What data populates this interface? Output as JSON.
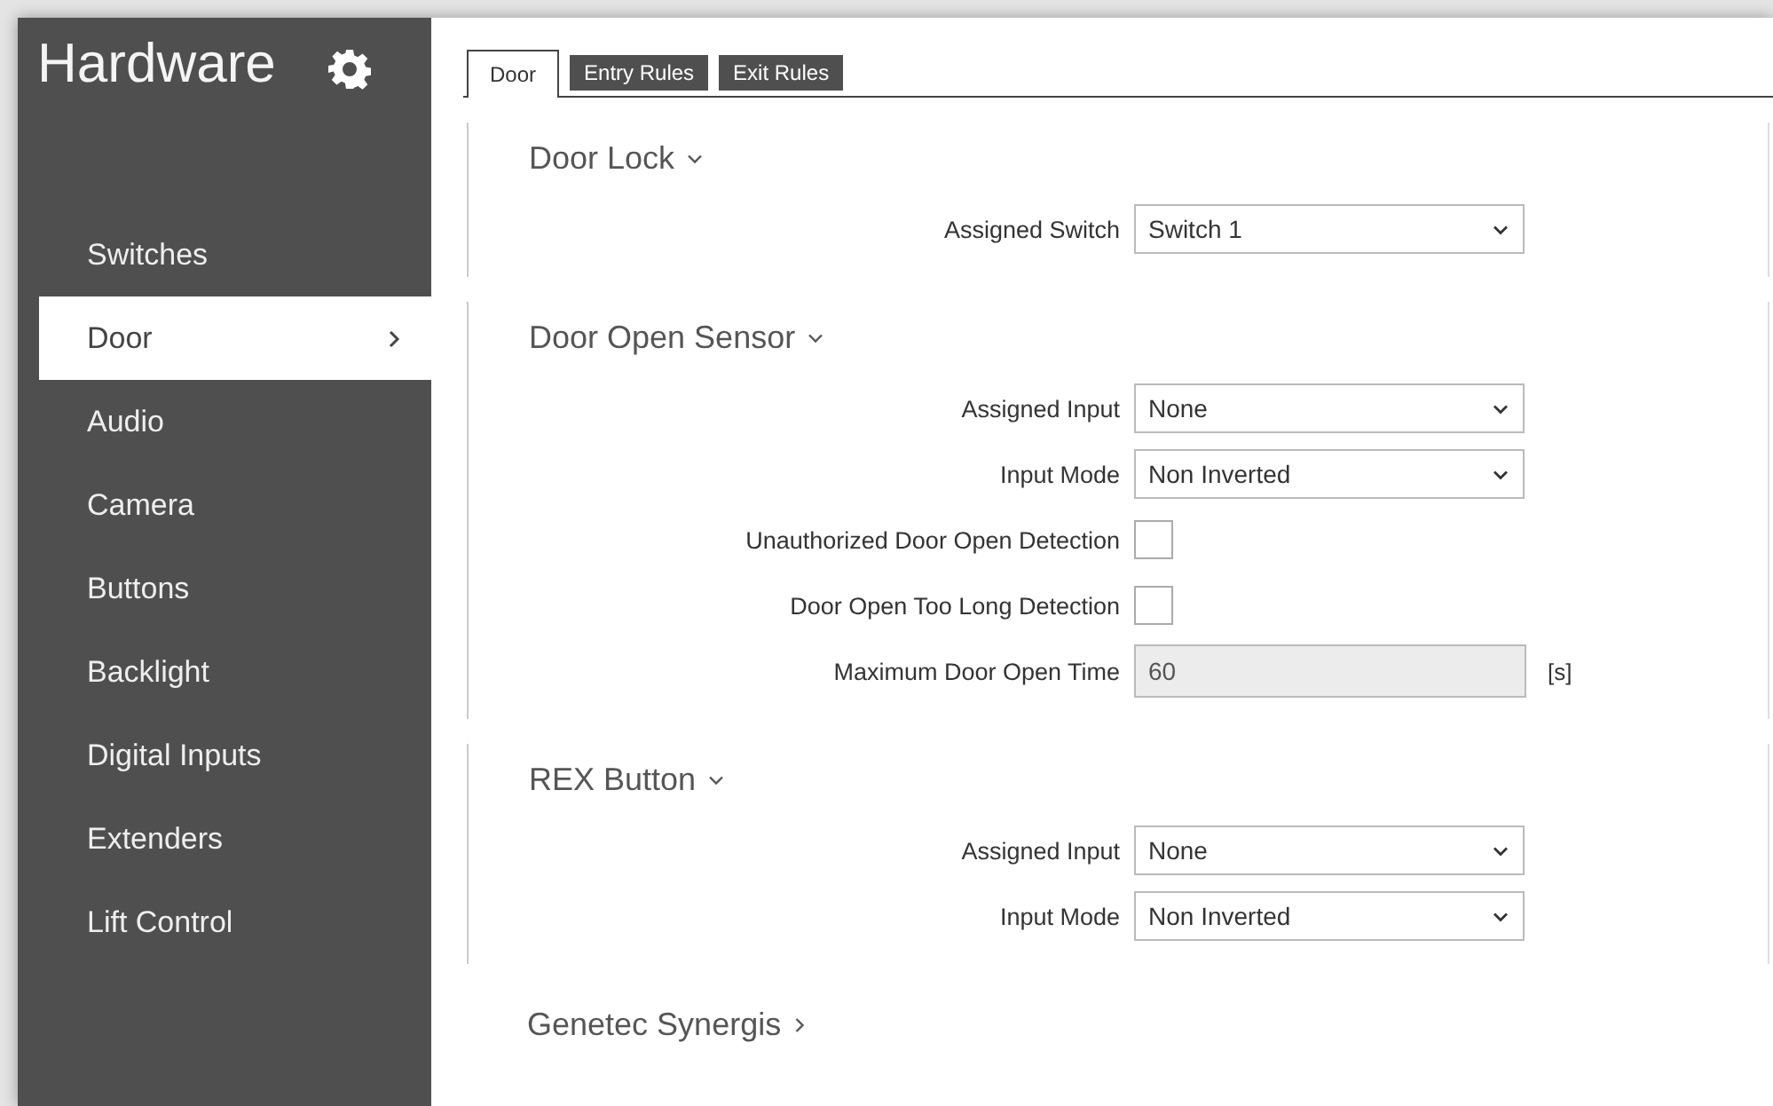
{
  "sidebar": {
    "title": "Hardware",
    "items": [
      {
        "label": "Switches",
        "selected": false
      },
      {
        "label": "Door",
        "selected": true
      },
      {
        "label": "Audio",
        "selected": false
      },
      {
        "label": "Camera",
        "selected": false
      },
      {
        "label": "Buttons",
        "selected": false
      },
      {
        "label": "Backlight",
        "selected": false
      },
      {
        "label": "Digital Inputs",
        "selected": false
      },
      {
        "label": "Extenders",
        "selected": false
      },
      {
        "label": "Lift Control",
        "selected": false
      }
    ]
  },
  "tabs": [
    {
      "label": "Door",
      "selected": true
    },
    {
      "label": "Entry Rules",
      "selected": false
    },
    {
      "label": "Exit Rules",
      "selected": false
    }
  ],
  "sections": [
    {
      "title": "Door Lock",
      "expanded": true,
      "fields": [
        {
          "kind": "select",
          "label": "Assigned Switch",
          "value": "Switch 1"
        }
      ]
    },
    {
      "title": "Door Open Sensor",
      "expanded": true,
      "fields": [
        {
          "kind": "select",
          "label": "Assigned Input",
          "value": "None"
        },
        {
          "kind": "select",
          "label": "Input Mode",
          "value": "Non Inverted"
        },
        {
          "kind": "checkbox",
          "label": "Unauthorized Door Open Detection",
          "checked": false
        },
        {
          "kind": "checkbox",
          "label": "Door Open Too Long Detection",
          "checked": false
        },
        {
          "kind": "text",
          "label": "Maximum Door Open Time",
          "value": "60",
          "disabled": true,
          "unit": "[s]"
        }
      ]
    },
    {
      "title": "REX Button",
      "expanded": true,
      "fields": [
        {
          "kind": "select",
          "label": "Assigned Input",
          "value": "None"
        },
        {
          "kind": "select",
          "label": "Input Mode",
          "value": "Non Inverted"
        }
      ]
    },
    {
      "title": "Genetec Synergis",
      "expanded": false
    }
  ]
}
